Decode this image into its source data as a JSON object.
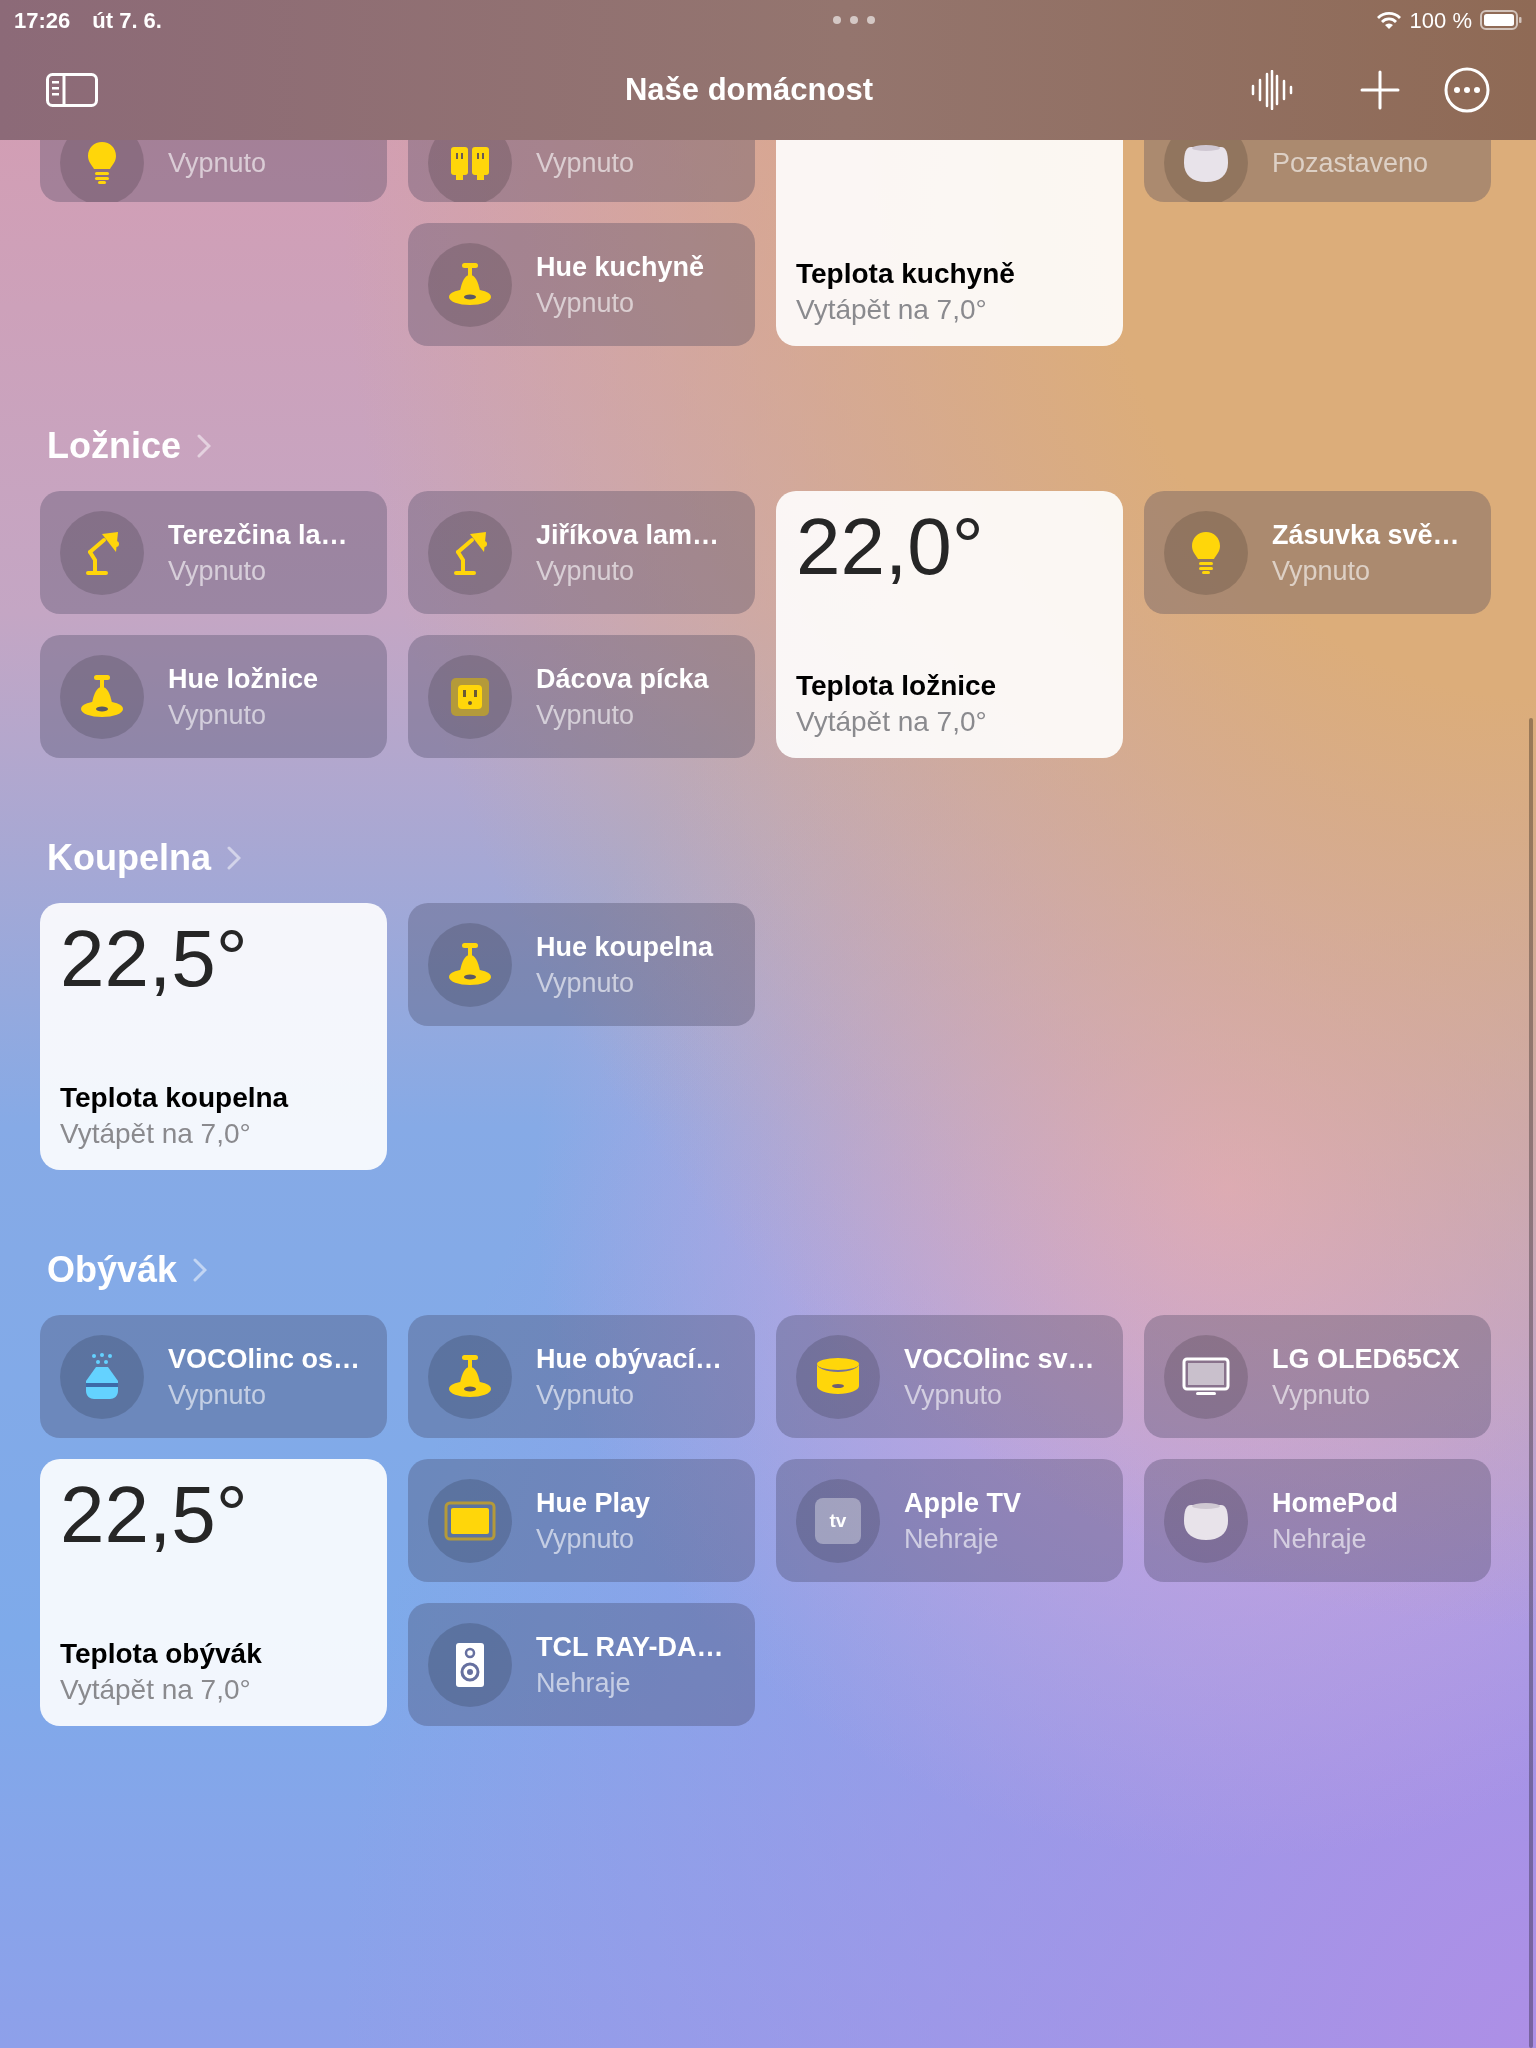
{
  "status_bar": {
    "time": "17:26",
    "date": "út 7. 6.",
    "battery": "100 %"
  },
  "header": {
    "title": "Naše domácnost"
  },
  "sections": [
    {
      "items": [
        {
          "kind": "bulb",
          "status": "Vypnuto"
        },
        {
          "kind": "outlet-strip",
          "status": "Vypnuto"
        },
        {
          "kind": "homepod",
          "status": "Pozastaveno"
        },
        {
          "kind": "pendant",
          "name": "Hue kuchyně",
          "status": "Vypnuto"
        },
        {
          "kind": "thermostat",
          "name": "Teplota kuchyně",
          "status": "Vytápět na 7,0°"
        }
      ]
    },
    {
      "title": "Ložnice",
      "items": [
        {
          "kind": "desk-lamp",
          "name": "Terezčina la…",
          "status": "Vypnuto"
        },
        {
          "kind": "desk-lamp",
          "name": "Jiříkova lam…",
          "status": "Vypnuto"
        },
        {
          "kind": "thermostat",
          "temperature": "22,0°",
          "name": "Teplota ložnice",
          "status": "Vytápět na 7,0°"
        },
        {
          "kind": "bulb",
          "name": "Zásuvka svě…",
          "status": "Vypnuto"
        },
        {
          "kind": "pendant",
          "name": "Hue ložnice",
          "status": "Vypnuto"
        },
        {
          "kind": "outlet",
          "name": "Dácova pícka",
          "status": "Vypnuto"
        }
      ]
    },
    {
      "title": "Koupelna",
      "items": [
        {
          "kind": "thermostat",
          "temperature": "22,5°",
          "name": "Teplota koupelna",
          "status": "Vytápět na 7,0°"
        },
        {
          "kind": "pendant",
          "name": "Hue koupelna",
          "status": "Vypnuto"
        }
      ]
    },
    {
      "title": "Obývák",
      "items": [
        {
          "kind": "diffuser",
          "name": "VOCOlinc os…",
          "status": "Vypnuto"
        },
        {
          "kind": "pendant",
          "name": "Hue obývací…",
          "status": "Vypnuto"
        },
        {
          "kind": "ceiling-light",
          "name": "VOCOlinc sv…",
          "status": "Vypnuto"
        },
        {
          "kind": "tv",
          "name": "LG OLED65CX",
          "status": "Vypnuto"
        },
        {
          "kind": "thermostat",
          "temperature": "22,5°",
          "name": "Teplota obývák",
          "status": "Vytápět na 7,0°"
        },
        {
          "kind": "lightbar",
          "name": "Hue Play",
          "status": "Vypnuto"
        },
        {
          "kind": "apple-tv",
          "icon_text": "tv",
          "name": "Apple TV",
          "status": "Nehraje"
        },
        {
          "kind": "homepod",
          "name": "HomePod",
          "status": "Nehraje"
        },
        {
          "kind": "speaker",
          "name": "TCL RAY-DA…",
          "status": "Nehraje"
        }
      ]
    }
  ]
}
